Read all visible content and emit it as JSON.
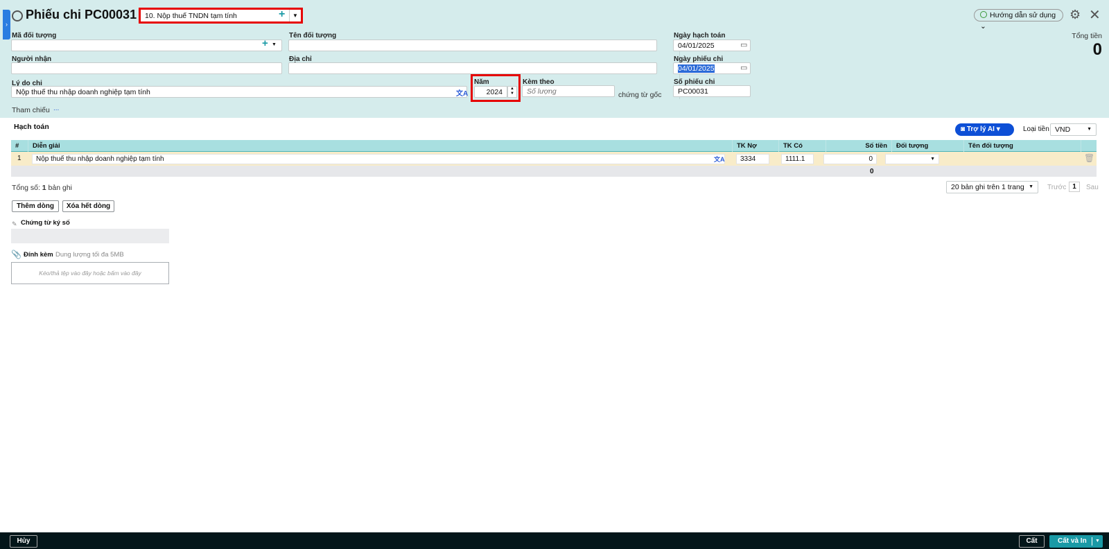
{
  "header": {
    "title": "Phiếu chi PC00031",
    "type_select": "10. Nộp thuế TNDN tạm tính",
    "help_label": "Hướng dẫn sử dụng",
    "total_label": "Tổng tiền",
    "total_value": "0"
  },
  "form": {
    "ma_doi_tuong_label": "Mã đối tượng",
    "ma_doi_tuong_value": "",
    "ten_doi_tuong_label": "Tên đối tượng",
    "ten_doi_tuong_value": "",
    "nguoi_nhan_label": "Người nhận",
    "nguoi_nhan_value": "",
    "dia_chi_label": "Địa chỉ",
    "dia_chi_value": "",
    "ly_do_label": "Lý do chi",
    "ly_do_value": "Nộp thuế thu nhập doanh nghiệp tạm tính",
    "nam_label": "Năm",
    "nam_value": "2024",
    "kem_theo_label": "Kèm theo",
    "kem_theo_placeholder": "Số lượng",
    "kem_theo_suffix": "chứng từ gốc",
    "ngay_hach_toan_label": "Ngày hạch toán",
    "ngay_hach_toan_value": "04/01/2025",
    "ngay_phieu_chi_label": "Ngày phiếu chi",
    "ngay_phieu_chi_value": "04/01/2025",
    "so_phieu_chi_label": "Số phiếu chi",
    "so_phieu_chi_value": "PC00031",
    "tham_chieu_label": "Tham chiếu",
    "tham_chieu_link": "..."
  },
  "accounting": {
    "title": "Hạch toán",
    "ai_button": "Trợ lý AI",
    "currency_label": "Loại tiền",
    "currency_value": "VND",
    "columns": [
      "#",
      "Diễn giải",
      "TK Nợ",
      "TK Có",
      "Số tiền",
      "Đối tượng",
      "Tên đối tượng"
    ],
    "rows": [
      {
        "no": "1",
        "dien_giai": "Nộp thuế thu nhập doanh nghiệp tạm tính",
        "tk_no": "3334",
        "tk_co": "1111.1",
        "so_tien": "0",
        "doi_tuong": "",
        "ten_doi_tuong": ""
      }
    ],
    "sum_so_tien": "0",
    "total_prefix": "Tổng số:",
    "total_count": "1",
    "total_suffix": "bản ghi",
    "page_size": "20 bản ghi trên 1 trang",
    "prev": "Trước",
    "page": "1",
    "next": "Sau",
    "add_row": "Thêm dòng",
    "delete_all": "Xóa hết dòng"
  },
  "signed": {
    "label": "Chứng từ ký số"
  },
  "attach": {
    "label": "Đính kèm",
    "limit": "Dung lượng tối đa 5MB",
    "drop_text": "Kéo/thả tệp vào đây hoặc bấm vào đây"
  },
  "footer": {
    "cancel": "Hủy",
    "save": "Cất",
    "save_print": "Cất và In"
  },
  "colors": {
    "header_bg": "#d5ecec",
    "table_header": "#a8dfe0",
    "accent": "#1a9aa6",
    "ai_blue": "#0d4fd6",
    "highlight": "#e60000"
  }
}
